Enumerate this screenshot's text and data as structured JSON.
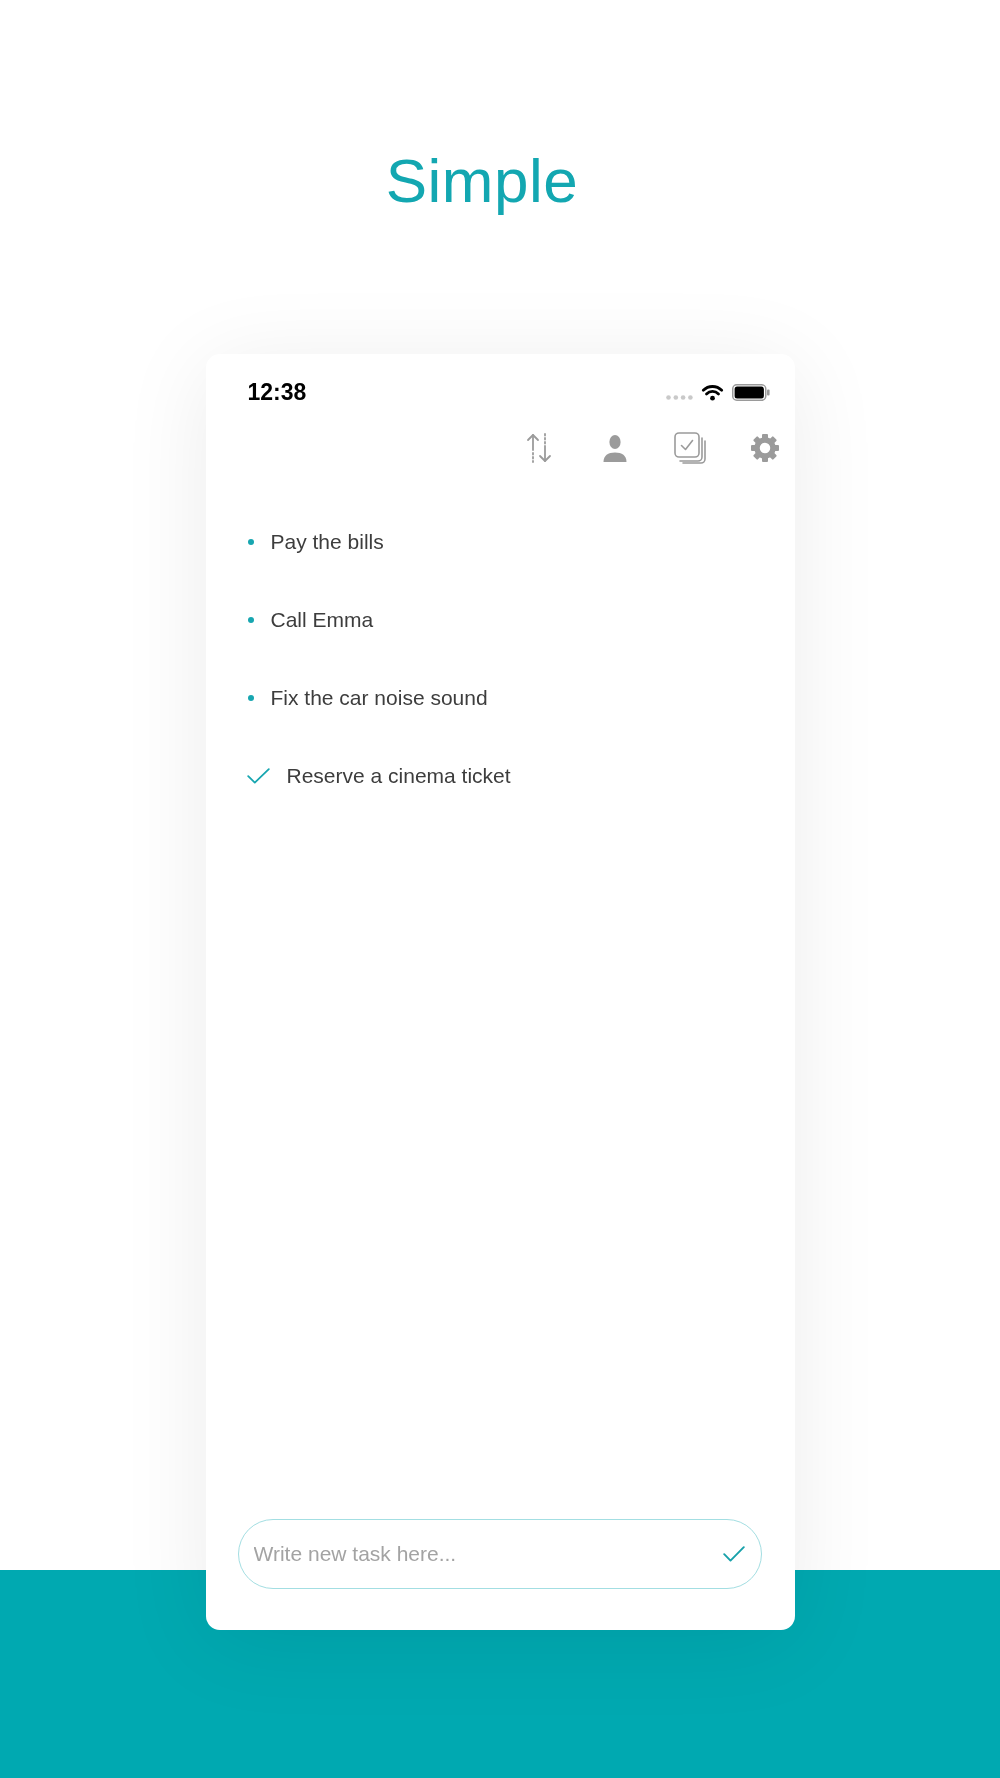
{
  "heading": "Simple",
  "status_bar": {
    "time": "12:38"
  },
  "tasks": [
    {
      "text": "Pay the bills",
      "done": false
    },
    {
      "text": "Call Emma",
      "done": false
    },
    {
      "text": "Fix the car noise sound",
      "done": false
    },
    {
      "text": "Reserve a cinema ticket",
      "done": true
    }
  ],
  "new_task": {
    "placeholder": "Write new task here..."
  }
}
